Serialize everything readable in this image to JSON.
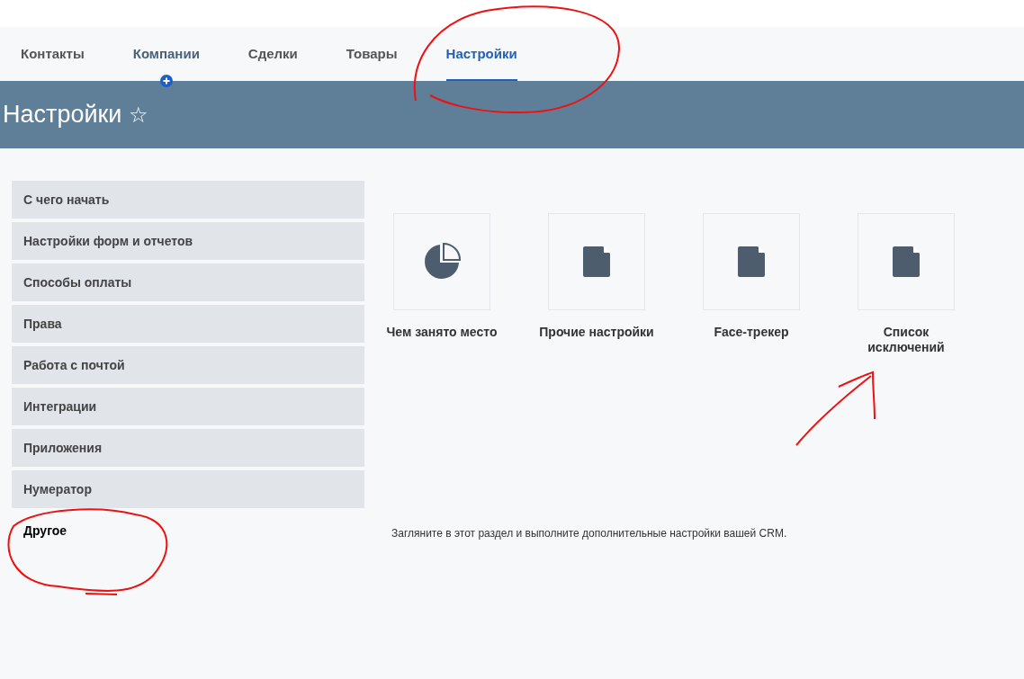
{
  "tabs": [
    {
      "label": "Контакты",
      "selected": false,
      "add_badge": false
    },
    {
      "label": "Компании",
      "selected": false,
      "add_badge": true
    },
    {
      "label": "Сделки",
      "selected": false,
      "add_badge": false
    },
    {
      "label": "Товары",
      "selected": false,
      "add_badge": false
    },
    {
      "label": "Настройки",
      "selected": true,
      "add_badge": false
    }
  ],
  "header": {
    "title": "Настройки",
    "star": "☆"
  },
  "sidebar": {
    "items": [
      {
        "label": "С чего начать",
        "selected": false
      },
      {
        "label": "Настройки форм и отчетов",
        "selected": false
      },
      {
        "label": "Способы оплаты",
        "selected": false
      },
      {
        "label": "Права",
        "selected": false
      },
      {
        "label": "Работа с почтой",
        "selected": false
      },
      {
        "label": "Интеграции",
        "selected": false
      },
      {
        "label": "Приложения",
        "selected": false
      },
      {
        "label": "Нумератор",
        "selected": false
      },
      {
        "label": "Другое",
        "selected": true
      }
    ]
  },
  "tiles": [
    {
      "kind": "pie",
      "label": "Чем занято место"
    },
    {
      "kind": "file",
      "label": "Прочие настройки"
    },
    {
      "kind": "file",
      "label": "Face-трекер"
    },
    {
      "kind": "file",
      "label": "Список исключений"
    }
  ],
  "description": "Загляните в этот раздел и выполните дополнительные настройки вашей CRM."
}
